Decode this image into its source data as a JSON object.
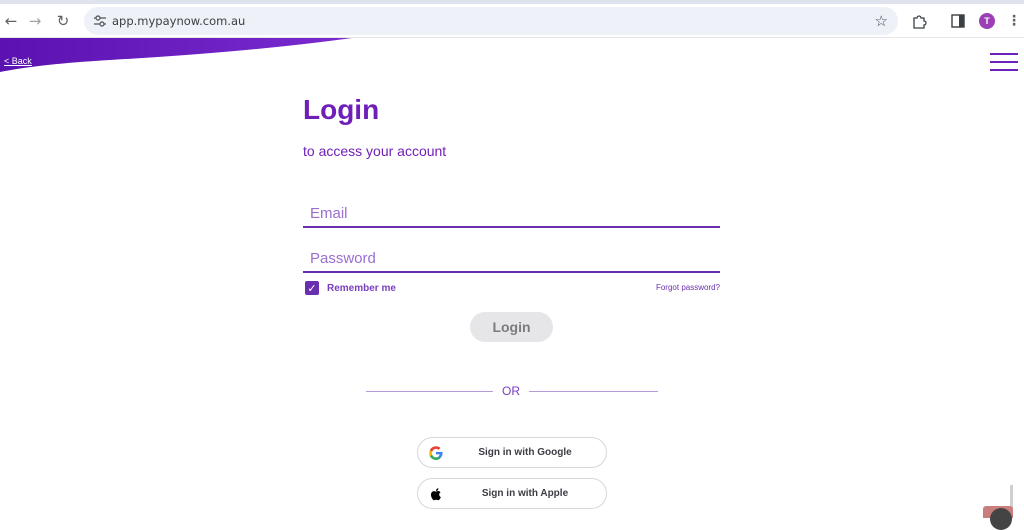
{
  "browser": {
    "url": "app.mypaynow.com.au",
    "avatar_initial": "T",
    "icons": [
      "back-arrow-icon",
      "forward-arrow-icon",
      "reload-icon",
      "site-settings-icon",
      "bookmark-star-icon",
      "extensions-icon",
      "side-panel-icon",
      "more-vert-icon"
    ]
  },
  "header": {
    "back_label": "< Back",
    "menu_icon": "hamburger-menu-icon"
  },
  "login": {
    "title": "Login",
    "subtitle": "to access your account",
    "email_placeholder": "Email",
    "password_placeholder": "Password",
    "remember_label": "Remember me",
    "remember_checked": true,
    "forgot_label": "Forgot password?",
    "login_button": "Login",
    "divider_text": "OR",
    "google_label": "Sign in with Google",
    "apple_label": "Sign in with Apple"
  },
  "colors": {
    "brand_purple": "#6f1fb8",
    "button_disabled_bg": "#e6e6e9"
  }
}
